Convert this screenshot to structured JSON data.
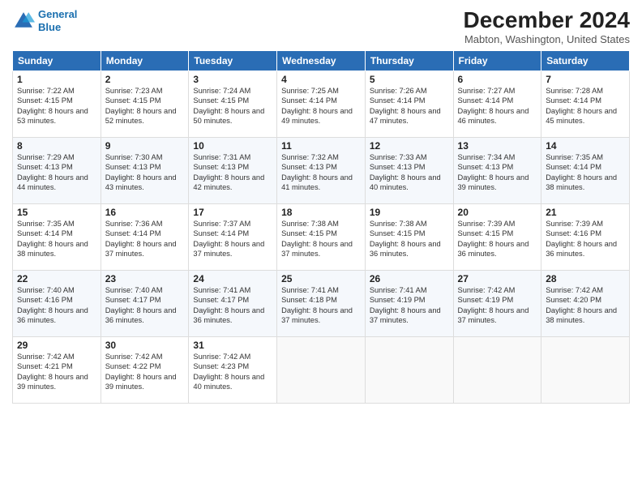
{
  "header": {
    "logo_line1": "General",
    "logo_line2": "Blue",
    "title": "December 2024",
    "location": "Mabton, Washington, United States"
  },
  "columns": [
    "Sunday",
    "Monday",
    "Tuesday",
    "Wednesday",
    "Thursday",
    "Friday",
    "Saturday"
  ],
  "weeks": [
    [
      {
        "day": "1",
        "rise": "Sunrise: 7:22 AM",
        "set": "Sunset: 4:15 PM",
        "daylight": "Daylight: 8 hours and 53 minutes."
      },
      {
        "day": "2",
        "rise": "Sunrise: 7:23 AM",
        "set": "Sunset: 4:15 PM",
        "daylight": "Daylight: 8 hours and 52 minutes."
      },
      {
        "day": "3",
        "rise": "Sunrise: 7:24 AM",
        "set": "Sunset: 4:15 PM",
        "daylight": "Daylight: 8 hours and 50 minutes."
      },
      {
        "day": "4",
        "rise": "Sunrise: 7:25 AM",
        "set": "Sunset: 4:14 PM",
        "daylight": "Daylight: 8 hours and 49 minutes."
      },
      {
        "day": "5",
        "rise": "Sunrise: 7:26 AM",
        "set": "Sunset: 4:14 PM",
        "daylight": "Daylight: 8 hours and 47 minutes."
      },
      {
        "day": "6",
        "rise": "Sunrise: 7:27 AM",
        "set": "Sunset: 4:14 PM",
        "daylight": "Daylight: 8 hours and 46 minutes."
      },
      {
        "day": "7",
        "rise": "Sunrise: 7:28 AM",
        "set": "Sunset: 4:14 PM",
        "daylight": "Daylight: 8 hours and 45 minutes."
      }
    ],
    [
      {
        "day": "8",
        "rise": "Sunrise: 7:29 AM",
        "set": "Sunset: 4:13 PM",
        "daylight": "Daylight: 8 hours and 44 minutes."
      },
      {
        "day": "9",
        "rise": "Sunrise: 7:30 AM",
        "set": "Sunset: 4:13 PM",
        "daylight": "Daylight: 8 hours and 43 minutes."
      },
      {
        "day": "10",
        "rise": "Sunrise: 7:31 AM",
        "set": "Sunset: 4:13 PM",
        "daylight": "Daylight: 8 hours and 42 minutes."
      },
      {
        "day": "11",
        "rise": "Sunrise: 7:32 AM",
        "set": "Sunset: 4:13 PM",
        "daylight": "Daylight: 8 hours and 41 minutes."
      },
      {
        "day": "12",
        "rise": "Sunrise: 7:33 AM",
        "set": "Sunset: 4:13 PM",
        "daylight": "Daylight: 8 hours and 40 minutes."
      },
      {
        "day": "13",
        "rise": "Sunrise: 7:34 AM",
        "set": "Sunset: 4:13 PM",
        "daylight": "Daylight: 8 hours and 39 minutes."
      },
      {
        "day": "14",
        "rise": "Sunrise: 7:35 AM",
        "set": "Sunset: 4:14 PM",
        "daylight": "Daylight: 8 hours and 38 minutes."
      }
    ],
    [
      {
        "day": "15",
        "rise": "Sunrise: 7:35 AM",
        "set": "Sunset: 4:14 PM",
        "daylight": "Daylight: 8 hours and 38 minutes."
      },
      {
        "day": "16",
        "rise": "Sunrise: 7:36 AM",
        "set": "Sunset: 4:14 PM",
        "daylight": "Daylight: 8 hours and 37 minutes."
      },
      {
        "day": "17",
        "rise": "Sunrise: 7:37 AM",
        "set": "Sunset: 4:14 PM",
        "daylight": "Daylight: 8 hours and 37 minutes."
      },
      {
        "day": "18",
        "rise": "Sunrise: 7:38 AM",
        "set": "Sunset: 4:15 PM",
        "daylight": "Daylight: 8 hours and 37 minutes."
      },
      {
        "day": "19",
        "rise": "Sunrise: 7:38 AM",
        "set": "Sunset: 4:15 PM",
        "daylight": "Daylight: 8 hours and 36 minutes."
      },
      {
        "day": "20",
        "rise": "Sunrise: 7:39 AM",
        "set": "Sunset: 4:15 PM",
        "daylight": "Daylight: 8 hours and 36 minutes."
      },
      {
        "day": "21",
        "rise": "Sunrise: 7:39 AM",
        "set": "Sunset: 4:16 PM",
        "daylight": "Daylight: 8 hours and 36 minutes."
      }
    ],
    [
      {
        "day": "22",
        "rise": "Sunrise: 7:40 AM",
        "set": "Sunset: 4:16 PM",
        "daylight": "Daylight: 8 hours and 36 minutes."
      },
      {
        "day": "23",
        "rise": "Sunrise: 7:40 AM",
        "set": "Sunset: 4:17 PM",
        "daylight": "Daylight: 8 hours and 36 minutes."
      },
      {
        "day": "24",
        "rise": "Sunrise: 7:41 AM",
        "set": "Sunset: 4:17 PM",
        "daylight": "Daylight: 8 hours and 36 minutes."
      },
      {
        "day": "25",
        "rise": "Sunrise: 7:41 AM",
        "set": "Sunset: 4:18 PM",
        "daylight": "Daylight: 8 hours and 37 minutes."
      },
      {
        "day": "26",
        "rise": "Sunrise: 7:41 AM",
        "set": "Sunset: 4:19 PM",
        "daylight": "Daylight: 8 hours and 37 minutes."
      },
      {
        "day": "27",
        "rise": "Sunrise: 7:42 AM",
        "set": "Sunset: 4:19 PM",
        "daylight": "Daylight: 8 hours and 37 minutes."
      },
      {
        "day": "28",
        "rise": "Sunrise: 7:42 AM",
        "set": "Sunset: 4:20 PM",
        "daylight": "Daylight: 8 hours and 38 minutes."
      }
    ],
    [
      {
        "day": "29",
        "rise": "Sunrise: 7:42 AM",
        "set": "Sunset: 4:21 PM",
        "daylight": "Daylight: 8 hours and 39 minutes."
      },
      {
        "day": "30",
        "rise": "Sunrise: 7:42 AM",
        "set": "Sunset: 4:22 PM",
        "daylight": "Daylight: 8 hours and 39 minutes."
      },
      {
        "day": "31",
        "rise": "Sunrise: 7:42 AM",
        "set": "Sunset: 4:23 PM",
        "daylight": "Daylight: 8 hours and 40 minutes."
      },
      null,
      null,
      null,
      null
    ]
  ]
}
